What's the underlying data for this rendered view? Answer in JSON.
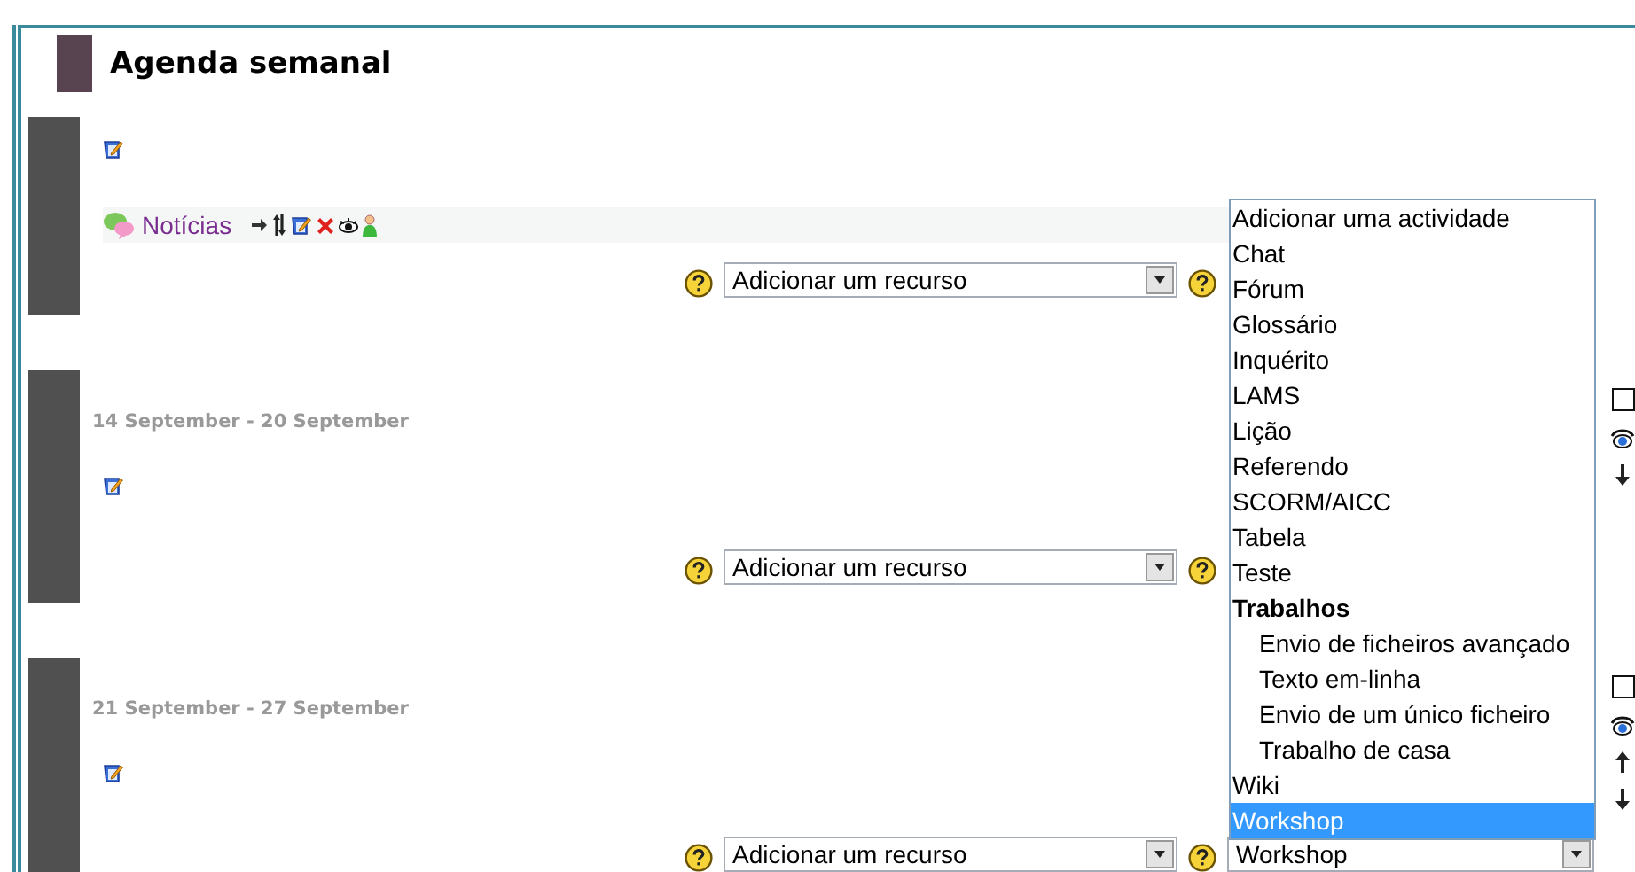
{
  "page_title": "Agenda semanal",
  "sections": [
    {
      "activities": [
        {
          "kind": "forum",
          "label": "Notícias"
        }
      ],
      "resource_select": {
        "value": "Adicionar um recurso"
      }
    },
    {
      "dates": "14 September - 20 September",
      "resource_select": {
        "value": "Adicionar um recurso"
      },
      "side_controls": [
        {
          "kind": "checkbox",
          "checked": false
        },
        {
          "kind": "eye"
        },
        {
          "kind": "down"
        }
      ]
    },
    {
      "dates": "21 September - 27 September",
      "resource_select": {
        "value": "Adicionar um recurso"
      },
      "activity_select": {
        "value": "Workshop"
      },
      "side_controls": [
        {
          "kind": "checkbox",
          "checked": false
        },
        {
          "kind": "eye"
        },
        {
          "kind": "up"
        },
        {
          "kind": "down"
        }
      ]
    }
  ],
  "activity_menu": {
    "options": [
      {
        "kind": "option",
        "label": "Adicionar uma actividade",
        "selected": false
      },
      {
        "kind": "option",
        "label": "Chat",
        "selected": false
      },
      {
        "kind": "option",
        "label": "Fórum",
        "selected": false
      },
      {
        "kind": "option",
        "label": "Glossário",
        "selected": false
      },
      {
        "kind": "option",
        "label": "Inquérito",
        "selected": false
      },
      {
        "kind": "option",
        "label": "LAMS",
        "selected": false
      },
      {
        "kind": "option",
        "label": "Lição",
        "selected": false
      },
      {
        "kind": "option",
        "label": "Referendo",
        "selected": false
      },
      {
        "kind": "option",
        "label": "SCORM/AICC",
        "selected": false
      },
      {
        "kind": "option",
        "label": "Tabela",
        "selected": false
      },
      {
        "kind": "option",
        "label": "Teste",
        "selected": false
      },
      {
        "kind": "group",
        "label": "Trabalhos",
        "children": [
          {
            "kind": "option",
            "label": "Envio de ficheiros avançado",
            "selected": false
          },
          {
            "kind": "option",
            "label": "Texto em-linha",
            "selected": false
          },
          {
            "kind": "option",
            "label": "Envio de um único ficheiro",
            "selected": false
          },
          {
            "kind": "option",
            "label": "Trabalho de casa",
            "selected": false
          }
        ]
      },
      {
        "kind": "option",
        "label": "Wiki",
        "selected": false
      },
      {
        "kind": "option",
        "label": "Workshop",
        "selected": true
      }
    ]
  }
}
